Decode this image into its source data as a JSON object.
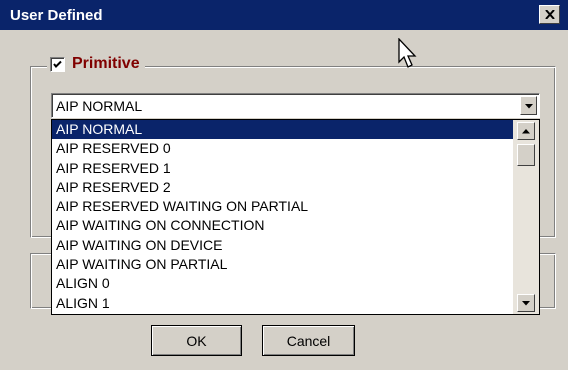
{
  "window": {
    "title": "User Defined"
  },
  "group": {
    "label": "Primitive",
    "checked": true
  },
  "combo": {
    "value": "AIP NORMAL"
  },
  "list": {
    "items": [
      "AIP NORMAL",
      "AIP RESERVED 0",
      "AIP RESERVED 1",
      "AIP RESERVED 2",
      "AIP RESERVED WAITING ON PARTIAL",
      "AIP WAITING ON CONNECTION",
      "AIP WAITING ON DEVICE",
      "AIP WAITING ON PARTIAL",
      "ALIGN 0",
      "ALIGN 1"
    ],
    "selected_index": 0
  },
  "buttons": {
    "ok": "OK",
    "cancel": "Cancel"
  },
  "icons": {
    "close": "close-icon",
    "checkmark": "checkmark-icon",
    "dropdown": "chevron-down-icon",
    "scroll_up": "arrow-up-icon",
    "scroll_down": "arrow-down-icon",
    "cursor": "mouse-pointer-icon"
  },
  "colors": {
    "titlebar": "#0a246a",
    "selection": "#0a246a",
    "legend": "#800000",
    "face": "#d4d0c8"
  }
}
